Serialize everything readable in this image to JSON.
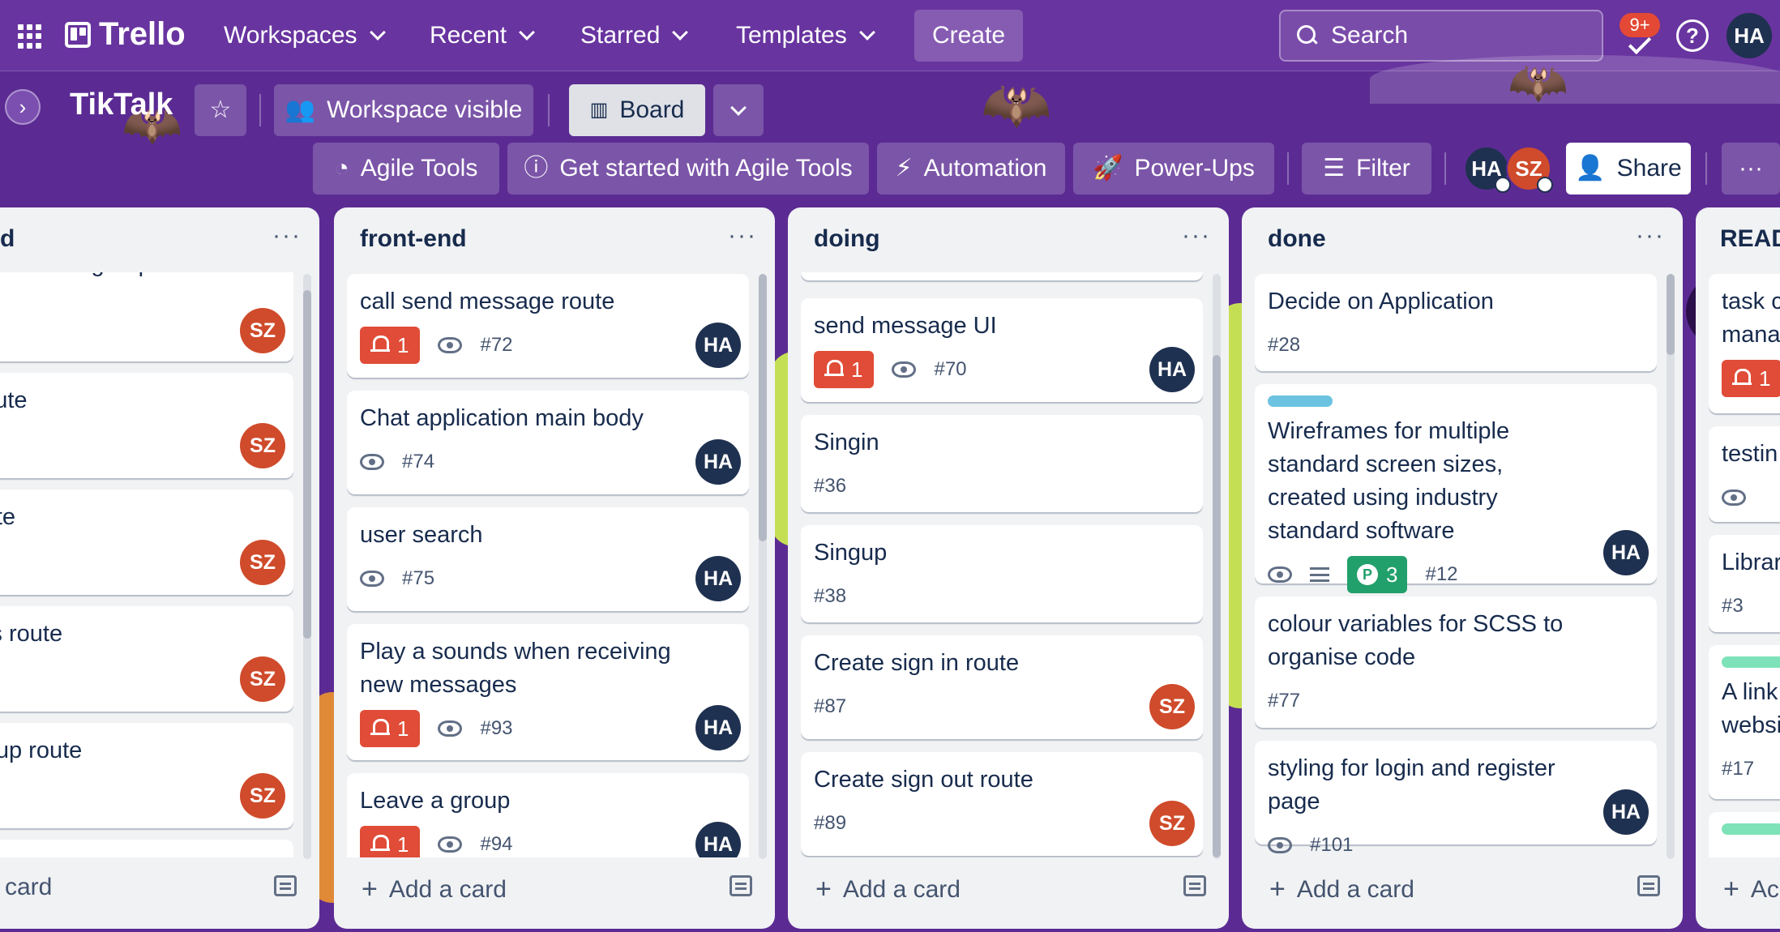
{
  "topnav": {
    "logo": "Trello",
    "menus": [
      {
        "label": "Workspaces"
      },
      {
        "label": "Recent"
      },
      {
        "label": "Starred"
      },
      {
        "label": "Templates"
      }
    ],
    "create_label": "Create",
    "search_placeholder": "Search",
    "notifications_count": "9+",
    "help_icon": "?",
    "user_initials": "HA"
  },
  "board": {
    "title": "TikTalk",
    "star_icon": "☆",
    "visibility_label": "Workspace visible",
    "view_label": "Board",
    "agile_tools_label": "Agile Tools",
    "get_started_label": "Get started with Agile Tools",
    "automation_label": "Automation",
    "powerups_label": "Power-Ups",
    "filter_label": "Filter",
    "members": [
      "HA",
      "SZ"
    ],
    "share_label": "Share",
    "more_icon": "···"
  },
  "colors": {
    "nav_bg": "#68349f",
    "board_bg": "#5b2b93",
    "avatar_ha": "#1f3150",
    "avatar_sz": "#cf4b2b",
    "notification_red": "#e04c37",
    "points_green": "#22a06b",
    "label_blue": "#6cc3e0",
    "label_green": "#7ee2b8"
  },
  "lists": [
    {
      "title": "d",
      "add_label": "card",
      "cards": [
        {
          "title": "essage, user and group\nn",
          "member": "SZ"
        },
        {
          "title": "ssage route",
          "member": "SZ"
        },
        {
          "title": "story route",
          "member": "SZ"
        },
        {
          "title": "et groups route",
          "member": "SZ"
        },
        {
          "title": "elete group route",
          "member": "SZ"
        }
      ]
    },
    {
      "title": "front-end",
      "add_label": "Add a card",
      "cards": [
        {
          "title": "call send message route",
          "notifications": "1",
          "number": "#72",
          "member": "HA"
        },
        {
          "title": "Chat application main body",
          "number": "#74",
          "member": "HA"
        },
        {
          "title": "user search",
          "number": "#75",
          "member": "HA"
        },
        {
          "title": "Play a sounds when receiving new messages",
          "notifications": "1",
          "number": "#93",
          "member": "HA"
        },
        {
          "title": "Leave a group",
          "notifications": "1",
          "number": "#94",
          "member": "HA"
        }
      ]
    },
    {
      "title": "doing",
      "add_label": "Add a card",
      "cards": [
        {
          "title": "send message UI",
          "notifications": "1",
          "number": "#70",
          "member": "HA"
        },
        {
          "title": "Singin",
          "number": "#36"
        },
        {
          "title": "Singup",
          "number": "#38"
        },
        {
          "title": "Create sign in route",
          "number": "#87",
          "member": "SZ"
        },
        {
          "title": "Create sign out route",
          "number": "#89",
          "member": "SZ"
        }
      ]
    },
    {
      "title": "done",
      "add_label": "Add a card",
      "cards": [
        {
          "title": "Decide on Application",
          "number": "#28"
        },
        {
          "title": "Wireframes for multiple standard screen sizes, created using industry standard software",
          "points": "3",
          "number": "#12",
          "member": "HA"
        },
        {
          "title": "colour variables for SCSS to organise code",
          "number": "#77"
        },
        {
          "title": "styling for login and register page",
          "number": "#101",
          "member": "HA"
        }
      ]
    },
    {
      "title": "READ",
      "add_label": "Ac",
      "cards": [
        {
          "title": "task c\nmanag",
          "notifications": "1"
        },
        {
          "title": "testin"
        },
        {
          "title": "Librar",
          "number": "#3"
        },
        {
          "title": "A link\nwebsi",
          "number": "#17"
        }
      ]
    }
  ]
}
